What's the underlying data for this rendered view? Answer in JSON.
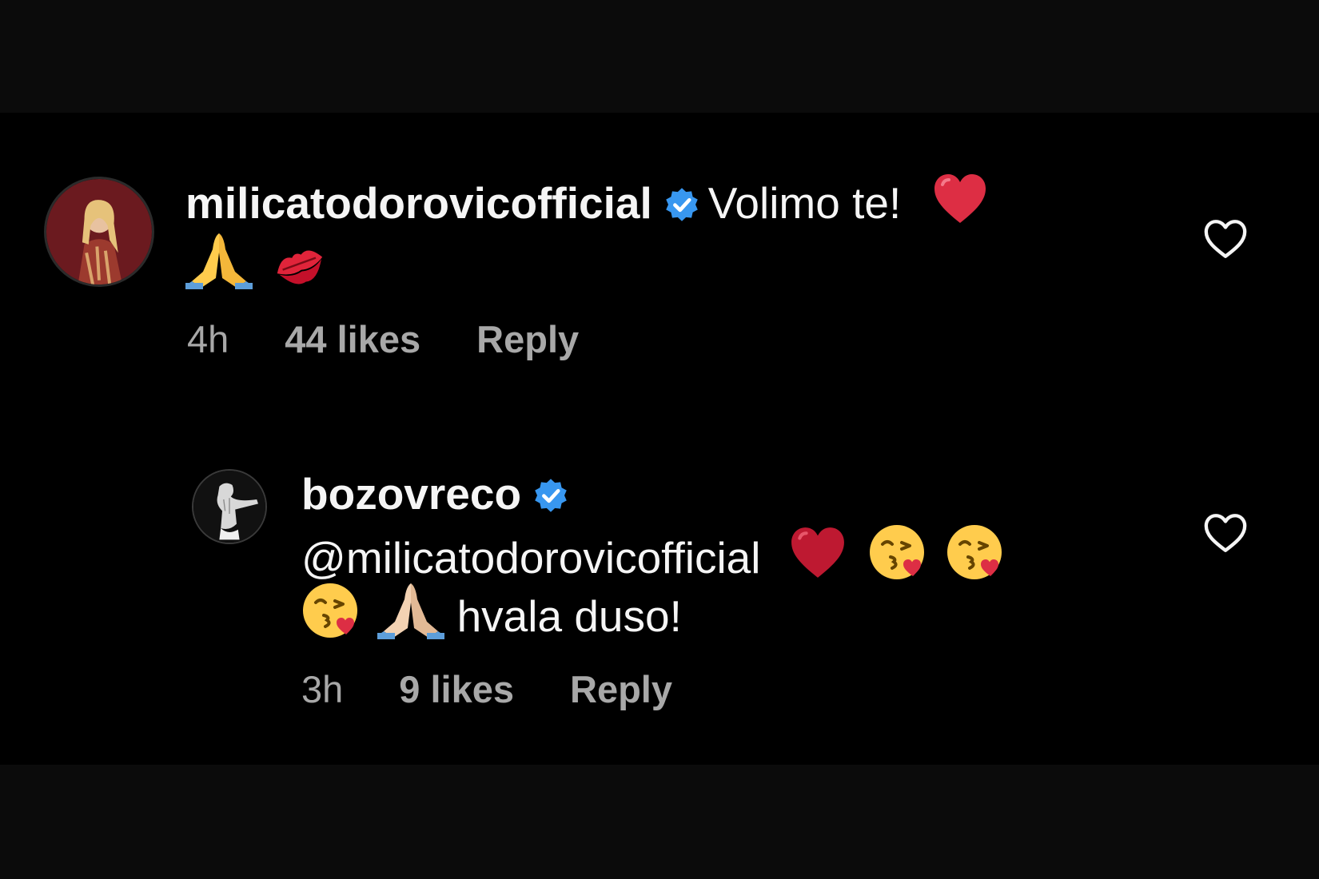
{
  "comments": [
    {
      "username": "milicatodorovicofficial",
      "text": "Volimo te!",
      "time": "4h",
      "likes": "44 likes",
      "reply": "Reply",
      "emojis": [
        "red-heart",
        "folded-hands",
        "kiss-mark"
      ]
    },
    {
      "username": "bozovreco",
      "mention": "@milicatodorovicofficial",
      "text": "hvala duso!",
      "time": "3h",
      "likes": "9 likes",
      "reply": "Reply",
      "emojis": [
        "red-heart",
        "face-blowing-kiss",
        "face-blowing-kiss",
        "face-blowing-kiss",
        "folded-hands-light"
      ]
    }
  ],
  "colors": {
    "background": "#000000",
    "text": "#f5f5f5",
    "meta": "#a8a8a8",
    "verified": "#3897f0"
  }
}
